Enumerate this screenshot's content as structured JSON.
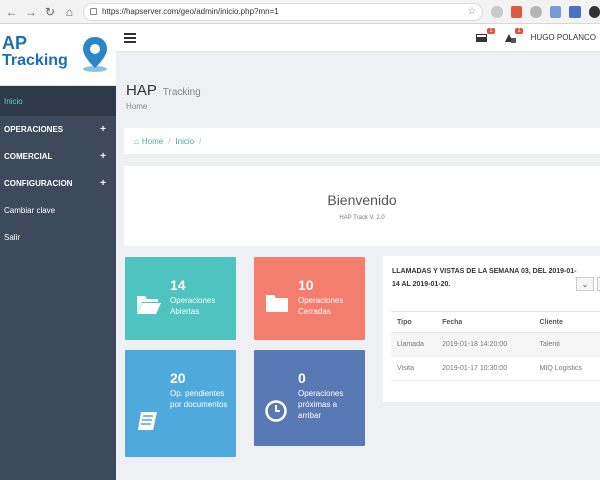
{
  "browser": {
    "url": "https://hapserver.com/geo/admin/inicio.php?mn=1"
  },
  "brand": {
    "line1": "AP",
    "line2": "Tracking"
  },
  "sidebar": {
    "items": [
      {
        "label": "Inicio"
      },
      {
        "label": "OPERACIONES",
        "expand": "+"
      },
      {
        "label": "COMERCIAL",
        "expand": "+"
      },
      {
        "label": "CONFIGURACION",
        "expand": "+"
      },
      {
        "label": "Cambiar clave"
      },
      {
        "label": "Salir"
      }
    ]
  },
  "topbar": {
    "notif_badge": "1",
    "task_badge": "1",
    "user_name": "HUGO POLANCO"
  },
  "page": {
    "title": "HAP",
    "title_sub": "Tracking",
    "subtitle": "Home"
  },
  "breadcrumb": {
    "home": "Home",
    "current": "Inicio",
    "sep": "/"
  },
  "welcome": {
    "title": "Bienvenido",
    "version": "HAP Track V. 2.0"
  },
  "tiles": [
    {
      "count": "14",
      "label": "Operaciones Abiertas",
      "color": "#4ec3c0"
    },
    {
      "count": "10",
      "label": "Operaciones Cerradas",
      "color": "#f37d6e"
    },
    {
      "count": "20",
      "label": "Op. pendientes por documentos",
      "color": "#4fa9dd"
    },
    {
      "count": "0",
      "label": "Operaciones próximas a arribar",
      "color": "#5979b5"
    }
  ],
  "panel": {
    "title_line1": "LLAMADAS Y VISTAS DE LA SEMANA 03, DEL 2019-01-",
    "title_line2": "14 AL 2019-01-20.",
    "columns": [
      "Tipo",
      "Fecha",
      "Cliente"
    ],
    "rows": [
      [
        "Llamada",
        "2019-01-18 14:20:00",
        "Talenti"
      ],
      [
        "Visita",
        "2019-01-17 10:30:00",
        "MIQ Logistics"
      ]
    ]
  },
  "colors": {
    "sidebar": "#3d4a5c",
    "accent": "#4aa89c",
    "brand": "#1c6fb3"
  }
}
